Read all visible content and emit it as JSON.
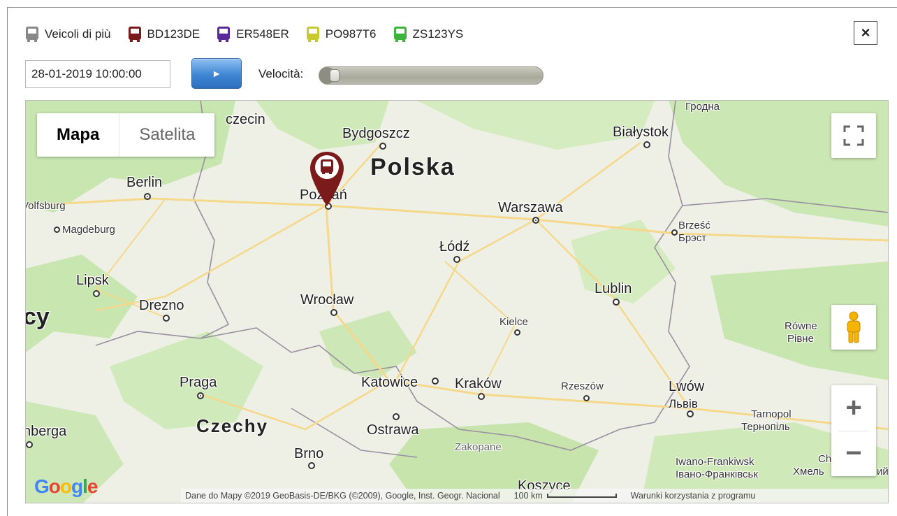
{
  "legend": {
    "items": [
      {
        "label": "Veicoli di più",
        "color": "#888888"
      },
      {
        "label": "BD123DE",
        "color": "#7b1a1a"
      },
      {
        "label": "ER548ER",
        "color": "#5b2a9a"
      },
      {
        "label": "PO987T6",
        "color": "#c8c830"
      },
      {
        "label": "ZS123YS",
        "color": "#3cb43c"
      }
    ]
  },
  "close_icon": "×",
  "controls": {
    "date_value": "28-01-2019 10:00:00",
    "play_icon": "►",
    "speed_label": "Velocità:",
    "speed_level": 0.04
  },
  "map": {
    "map_type": {
      "map": "Mapa",
      "satellite": "Satelita"
    },
    "countries": {
      "poland": "Polska",
      "czech": "Czechy"
    },
    "cities": {
      "szczecin": "czecin",
      "bydgoszcz": "Bydgoszcz",
      "bialystok": "Białystok",
      "grodno": "Гродна",
      "berlin": "Berlin",
      "poznan": "Poznań",
      "warszawa": "Warszawa",
      "wolfsburg": "Volfsburg",
      "magdeburg": "Magdeburg",
      "brzesc": "Brześć",
      "brest": "Брэст",
      "lodz": "Łódź",
      "lipsk": "Lipsk",
      "lublin": "Lublin",
      "drezno": "Drezno",
      "wroclaw": "Wrocław",
      "kielce": "Kielce",
      "rowne": "Równe",
      "rivne": "Рівне",
      "praga": "Praga",
      "katowice": "Katowice",
      "krakow": "Kraków",
      "rzeszow": "Rzeszów",
      "lwow": "Lwów",
      "lviv": "Львів",
      "tarnopol": "Tarnopol",
      "ternopil": "Тернопіль",
      "ostrawa": "Ostrawa",
      "nberga": "nberga",
      "zakopane": "Zakopane",
      "brno": "Brno",
      "iwano": "Iwano-Frankiwsk",
      "ivano": "Івано-Франківськ",
      "chm": "Chm",
      "khm": "Хмель",
      "koszyce": "Koszyce",
      "cy": "cy",
      "mi": "ий"
    },
    "zoom_in": "+",
    "zoom_out": "−",
    "google": {
      "g1": "G",
      "o1": "o",
      "o2": "o",
      "g2": "g",
      "l": "l",
      "e": "e"
    },
    "footer": {
      "attribution": "Dane do Mapy ©2019 GeoBasis-DE/BKG (©2009), Google, Inst. Geogr. Nacional",
      "scale": "100 km",
      "terms": "Warunki korzystania z programu"
    },
    "colors": {
      "water": "#aadaff",
      "green": "#c8e6b0",
      "road": "#f5d88a",
      "marker": "#7b1a1a"
    }
  }
}
